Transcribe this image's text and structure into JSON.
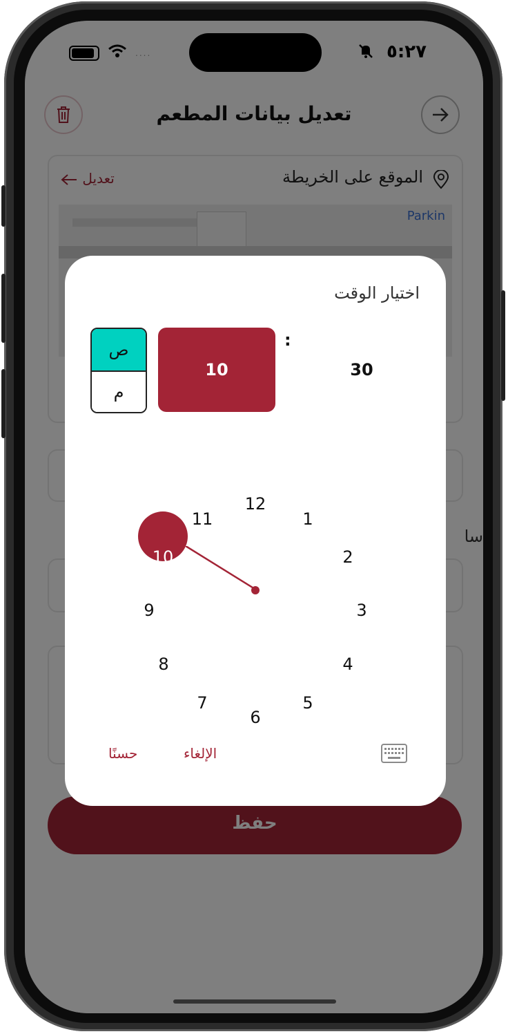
{
  "status_bar": {
    "time": "٥:٢٧"
  },
  "header": {
    "title": "تعديل بيانات المطعم"
  },
  "location_card": {
    "label": "الموقع على الخريطة",
    "edit_label": "تعديل",
    "map_caption": "Parkin"
  },
  "save_button": {
    "label": "حفظ"
  },
  "background_text": {
    "partial_label": "سا"
  },
  "time_picker": {
    "title": "اختيار الوقت",
    "hour": "10",
    "separator": ":",
    "minute": "30",
    "am_label": "ص",
    "pm_label": "م",
    "selected_hour": "10",
    "dial_numbers": [
      "12",
      "1",
      "2",
      "3",
      "4",
      "5",
      "6",
      "7",
      "8",
      "9",
      "10",
      "11"
    ],
    "cancel_label": "الإلغاء",
    "ok_label": "حسنًا",
    "keyboard_icon": "keyboard-icon"
  },
  "colors": {
    "accent": "#a32436",
    "am_selected": "#00d1c0"
  }
}
